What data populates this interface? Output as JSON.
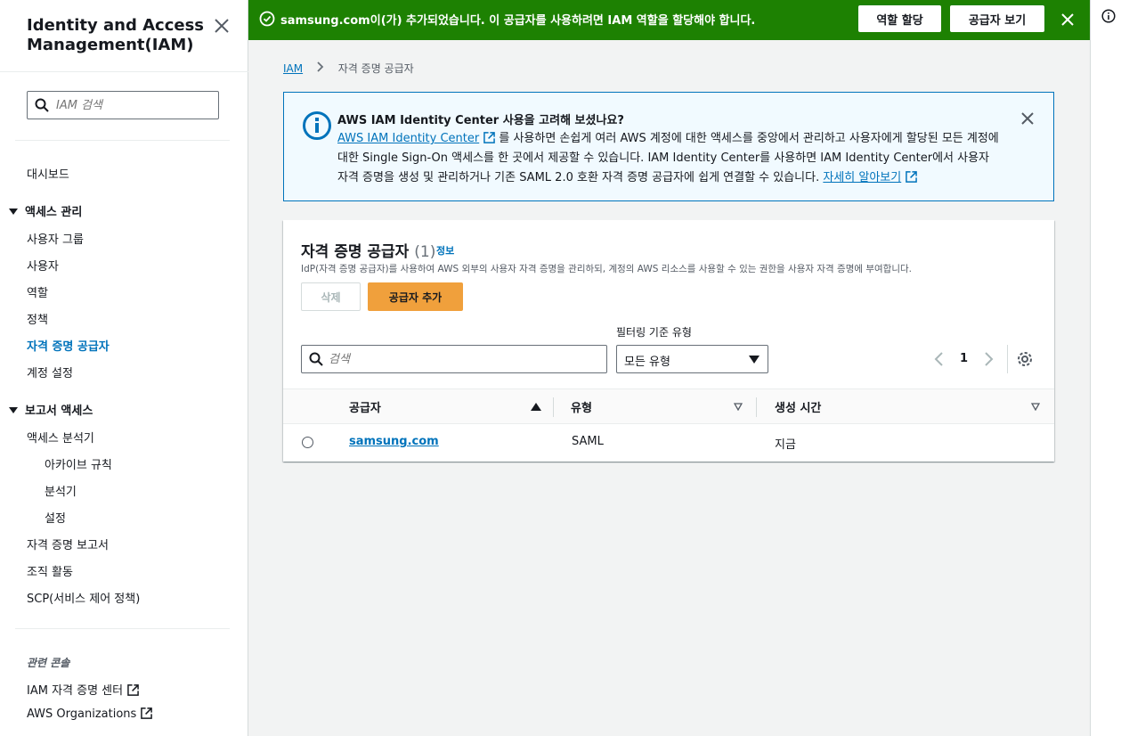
{
  "sidebar": {
    "title": "Identity and Access Management(IAM)",
    "search_placeholder": "IAM 검색",
    "dashboard": "대시보드",
    "access_management": {
      "label": "액세스 관리",
      "items": [
        "사용자 그룹",
        "사용자",
        "역할",
        "정책",
        "자격 증명 공급자",
        "계정 설정"
      ],
      "active": "자격 증명 공급자"
    },
    "access_reports": {
      "label": "보고서 액세스",
      "analyzer": "액세스 분석기",
      "analyzer_items": [
        "아카이브 규칙",
        "분석기",
        "설정"
      ],
      "items": [
        "자격 증명 보고서",
        "조직 활동",
        "SCP(서비스 제어 정책)"
      ]
    },
    "related_label": "관련 콘솔",
    "related": [
      "IAM 자격 증명 센터",
      "AWS Organizations"
    ]
  },
  "flash": {
    "message": "samsung.com이(가) 추가되었습니다. 이 공급자를 사용하려면 IAM 역할을 할당해야 합니다.",
    "assign_role_button": "역할 할당",
    "view_provider_button": "공급자 보기",
    "color": "#1d8102"
  },
  "breadcrumb": {
    "root": "IAM",
    "current": "자격 증명 공급자"
  },
  "infobox": {
    "title": "AWS IAM Identity Center 사용을 고려해 보셨나요?",
    "link": "AWS IAM Identity Center",
    "line1_rest": " 를 사용하면 손쉽게 여러 AWS 계정에 대한 액세스를 중앙에서 관리하고 사용자에게 할당된 모든 계정에 대한 Single Sign-On 액세스를 한 곳에서 제공할 수 있습니다. IAM Identity Center를 사용하면 IAM Identity Center에서 사용자 자격 증명을 생성 및 관리하거나 기존 SAML 2.0 호환 자격 증명 공급자에 쉽게 연결할 수 있습니다. ",
    "learn_more": "자세히 알아보기"
  },
  "panel": {
    "title": "자격 증명 공급자",
    "count": "(1)",
    "info_link": "정보",
    "description": "IdP(자격 증명 공급자)를 사용하여 AWS 외부의 사용자 자격 증명을 관리하되, 계정의 AWS 리소스를 사용할 수 있는 권한을 사용자 자격 증명에 부여합니다.",
    "delete_button": "삭제",
    "add_button": "공급자 추가",
    "search_placeholder": "검색",
    "filter_label": "필터링 기준 유형",
    "filter_value": "모든 유형",
    "page": "1",
    "columns": [
      "공급자",
      "유형",
      "생성 시간"
    ],
    "rows": [
      {
        "provider": "samsung.com",
        "type": "SAML",
        "created": "지금"
      }
    ]
  }
}
